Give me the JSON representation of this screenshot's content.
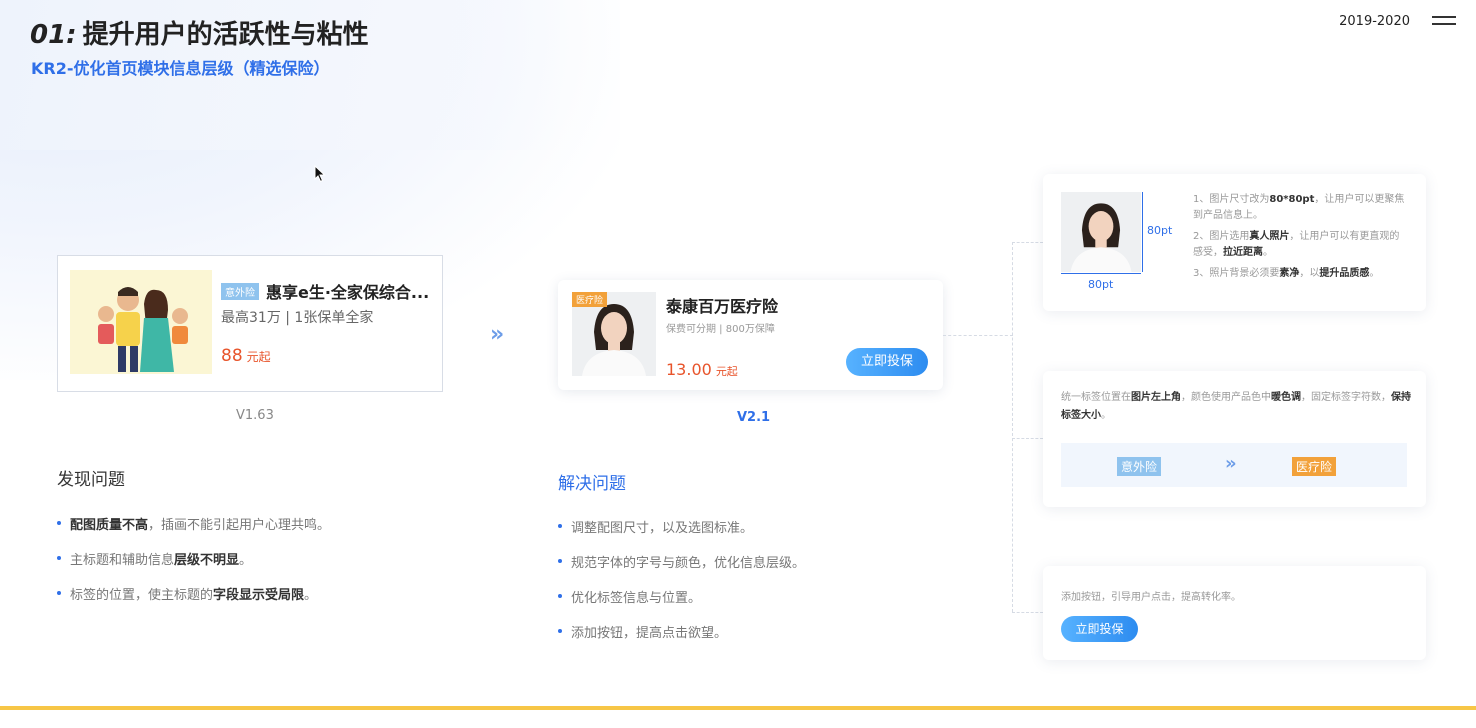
{
  "header": {
    "title_num": "01:",
    "title": "提升用户的活跃性与粘性",
    "subtitle": "KR2-优化首页模块信息层级（精选保险）",
    "year": "2019-2020"
  },
  "old_card": {
    "tag": "意外险",
    "name": "惠享e生·全家保综合...",
    "desc": "最高31万 | 1张保单全家",
    "price": "88",
    "price_unit": "元起",
    "version": "V1.63"
  },
  "new_card": {
    "tag": "医疗险",
    "name": "泰康百万医疗险",
    "desc": "保费可分期 | 800万保障",
    "price": "13.00",
    "price_unit": "元起",
    "button": "立即投保",
    "version": "V2.1"
  },
  "problems": {
    "heading": "发现问题",
    "items": [
      {
        "bold": "配图质量不高",
        "rest": "，插画不能引起用户心理共鸣。"
      },
      {
        "pre": "主标题和辅助信息",
        "bold": "层级不明显",
        "rest": "。"
      },
      {
        "pre": "标签的位置，使主标题的",
        "bold": "字段显示受局限",
        "rest": "。"
      }
    ]
  },
  "solutions": {
    "heading": "解决问题",
    "items": [
      "调整配图尺寸，以及选图标准。",
      "规范字体的字号与颜色，优化信息层级。",
      "优化标签信息与位置。",
      "添加按钮，提高点击欲望。"
    ]
  },
  "panel_image": {
    "dim_v": "80pt",
    "dim_h": "80pt",
    "note1_pre": "1、图片尺寸改为",
    "note1_bold": "80*80pt",
    "note1_rest": "，让用户可以更聚焦到产品信息上。",
    "note2_pre": "2、图片选用",
    "note2_bold": "真人照片",
    "note2_mid": "，让用户可以有更直观的感受，",
    "note2_bold2": "拉近距离",
    "note2_rest": "。",
    "note3_pre": "3、照片背景必须要",
    "note3_bold": "素净",
    "note3_mid": "，以",
    "note3_bold2": "提升品质感",
    "note3_rest": "。"
  },
  "panel_tag": {
    "t1": "统一标签位置在",
    "b1": "图片左上角",
    "t2": "，颜色使用产品色中",
    "b2": "暖色调",
    "t3": "，固定标签字符数，",
    "b3": "保持标签大小",
    "t4": "。",
    "tag_old": "意外险",
    "tag_new": "医疗险"
  },
  "panel_button": {
    "text": "添加按钮，引导用户点击，提高转化率。",
    "button": "立即投保"
  },
  "colors": {
    "accent_blue": "#2f6fe8",
    "price_red": "#e8542b",
    "tag_orange": "#f2a13a",
    "tag_light_blue": "#8fc3ee",
    "bottom_bar": "#f7c646"
  }
}
